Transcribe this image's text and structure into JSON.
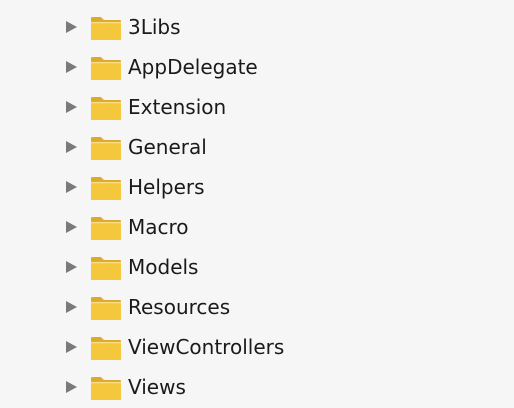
{
  "folders": [
    {
      "name": "3Libs",
      "icon": "folder-icon"
    },
    {
      "name": "AppDelegate",
      "icon": "folder-icon"
    },
    {
      "name": "Extension",
      "icon": "folder-icon"
    },
    {
      "name": "General",
      "icon": "folder-icon"
    },
    {
      "name": "Helpers",
      "icon": "folder-icon"
    },
    {
      "name": "Macro",
      "icon": "folder-icon"
    },
    {
      "name": "Models",
      "icon": "folder-icon"
    },
    {
      "name": "Resources",
      "icon": "folder-icon"
    },
    {
      "name": "ViewControllers",
      "icon": "folder-icon"
    },
    {
      "name": "Views",
      "icon": "folder-icon"
    }
  ],
  "colors": {
    "background": "#f6f6f6",
    "folder_front": "#f5c73c",
    "folder_back": "#e0a92a",
    "disclosure": "#7a7a7a",
    "text": "#1a1a1a"
  }
}
